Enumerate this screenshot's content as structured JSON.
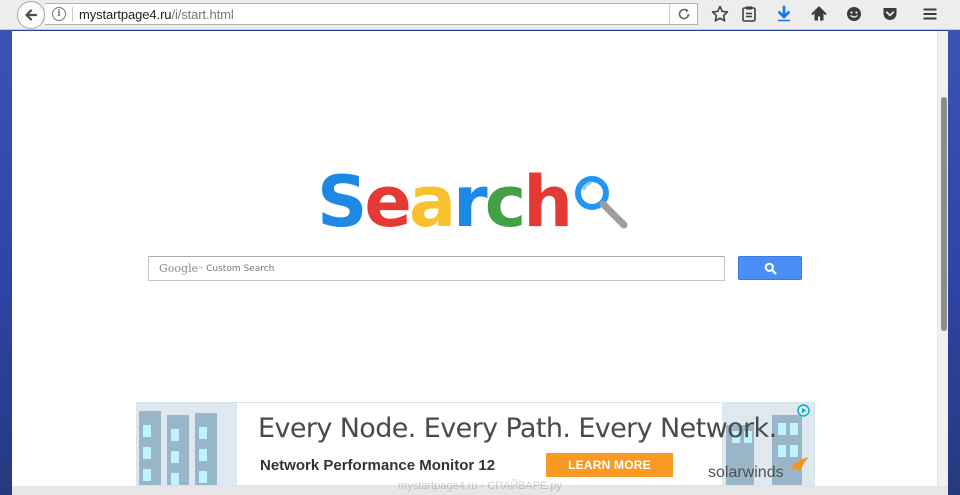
{
  "toolbar": {
    "url_domain": "mystartpage4.ru",
    "url_path": "/i/start.html"
  },
  "page": {
    "logo_letters": [
      {
        "char": "S",
        "color": "#1e88e5"
      },
      {
        "char": "e",
        "color": "#e53935"
      },
      {
        "char": "a",
        "color": "#fbc02d"
      },
      {
        "char": "r",
        "color": "#1e88e5"
      },
      {
        "char": "c",
        "color": "#43a047"
      },
      {
        "char": "h",
        "color": "#e53935"
      }
    ],
    "search": {
      "google_word": "Google",
      "tm": "™",
      "custom_search": "Custom Search"
    }
  },
  "ad": {
    "headline": "Every Node. Every Path. Every Network.",
    "product": "Network Performance Monitor 12",
    "cta": "LEARN MORE",
    "brand": "solarwinds"
  },
  "watermark": "mystartpage4.ru - СПАЙВАРЕ.ру",
  "colors": {
    "accent_blue": "#4a8ff5",
    "cta_orange": "#f99a25"
  }
}
